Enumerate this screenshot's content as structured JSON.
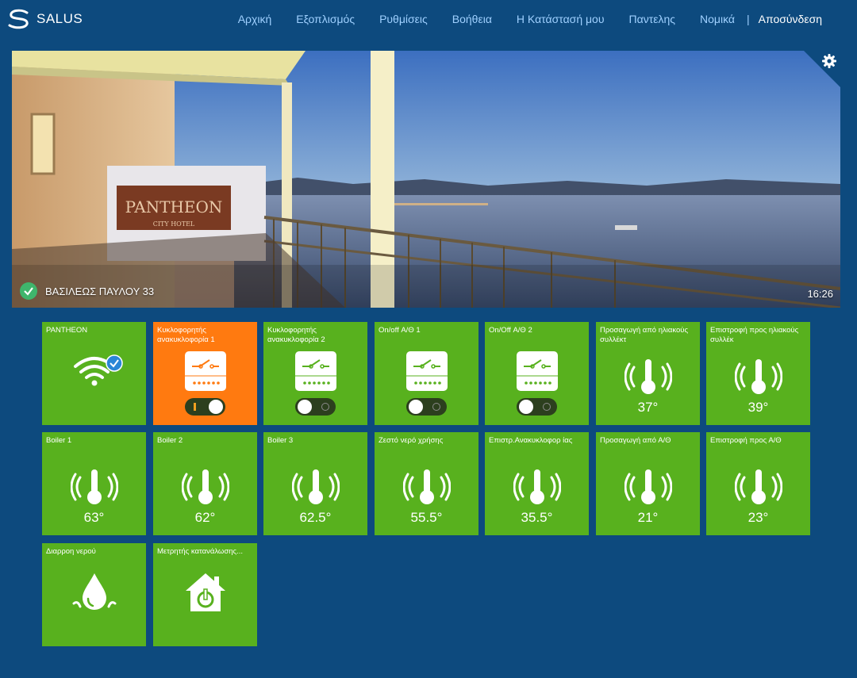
{
  "header": {
    "brand": "SALUS",
    "nav": [
      "Αρχική",
      "Εξοπλισμός",
      "Ρυθμίσεις",
      "Βοήθεια",
      "Η Κατάστασή μου",
      "Παντελης",
      "Νομικά"
    ],
    "separator": "|",
    "logout": "Αποσύνδεση"
  },
  "hero": {
    "sign_line1": "PANTHEON",
    "sign_line2": "CITY HOTEL",
    "address": "ΒΑΣΙΛΕΩΣ ΠΑΥΛΟΥ 33",
    "time": "16:26",
    "status": "online"
  },
  "tiles": [
    {
      "title": "PANTHEON",
      "type": "gateway"
    },
    {
      "title": "Κυκλοφορητής ανακυκλοφορία 1",
      "type": "switch",
      "state": "on",
      "color": "#ff7a10"
    },
    {
      "title": "Κυκλοφορητής ανακυκλοφορία 2",
      "type": "switch",
      "state": "off"
    },
    {
      "title": "On/off Α/Θ 1",
      "type": "switch",
      "state": "off"
    },
    {
      "title": "On/Off Α/Θ 2",
      "type": "switch",
      "state": "off"
    },
    {
      "title": "Προσαγωγή από ηλιακούς συλλέκτ",
      "type": "sensor",
      "value": "37°"
    },
    {
      "title": "Επιστροφή προς ηλιακούς συλλέκ",
      "type": "sensor",
      "value": "39°"
    },
    {
      "title": "Boiler 1",
      "type": "sensor",
      "value": "63°"
    },
    {
      "title": "Boiler 2",
      "type": "sensor",
      "value": "62°"
    },
    {
      "title": "Boiler 3",
      "type": "sensor",
      "value": "62.5°"
    },
    {
      "title": "Ζεστό νερό χρήσης",
      "type": "sensor",
      "value": "55.5°"
    },
    {
      "title": "Επιστρ.Ανακυκλοφορ ίας",
      "type": "sensor",
      "value": "35.5°"
    },
    {
      "title": "Προσαγωγή από Α/Θ",
      "type": "sensor",
      "value": "21°"
    },
    {
      "title": "Επιστροφή προς Α/Θ",
      "type": "sensor",
      "value": "23°"
    },
    {
      "title": "Διαρροη νερού",
      "type": "leak"
    },
    {
      "title": "Μετρητής κατανάλωσης...",
      "type": "meter"
    }
  ],
  "colors": {
    "background": "#0d4a7e",
    "tile": "#58b11e",
    "tile_active": "#ff7a10",
    "nav_link": "#9fd0ff"
  },
  "icons": {
    "logo": "salus-logo-icon",
    "settings": "gear-icon",
    "status": "check-circle-icon",
    "wifi": "wifi-icon",
    "relay": "relay-icon",
    "thermo": "thermometer-icon",
    "leak": "water-drop-icon",
    "meter": "smart-plug-house-icon"
  }
}
